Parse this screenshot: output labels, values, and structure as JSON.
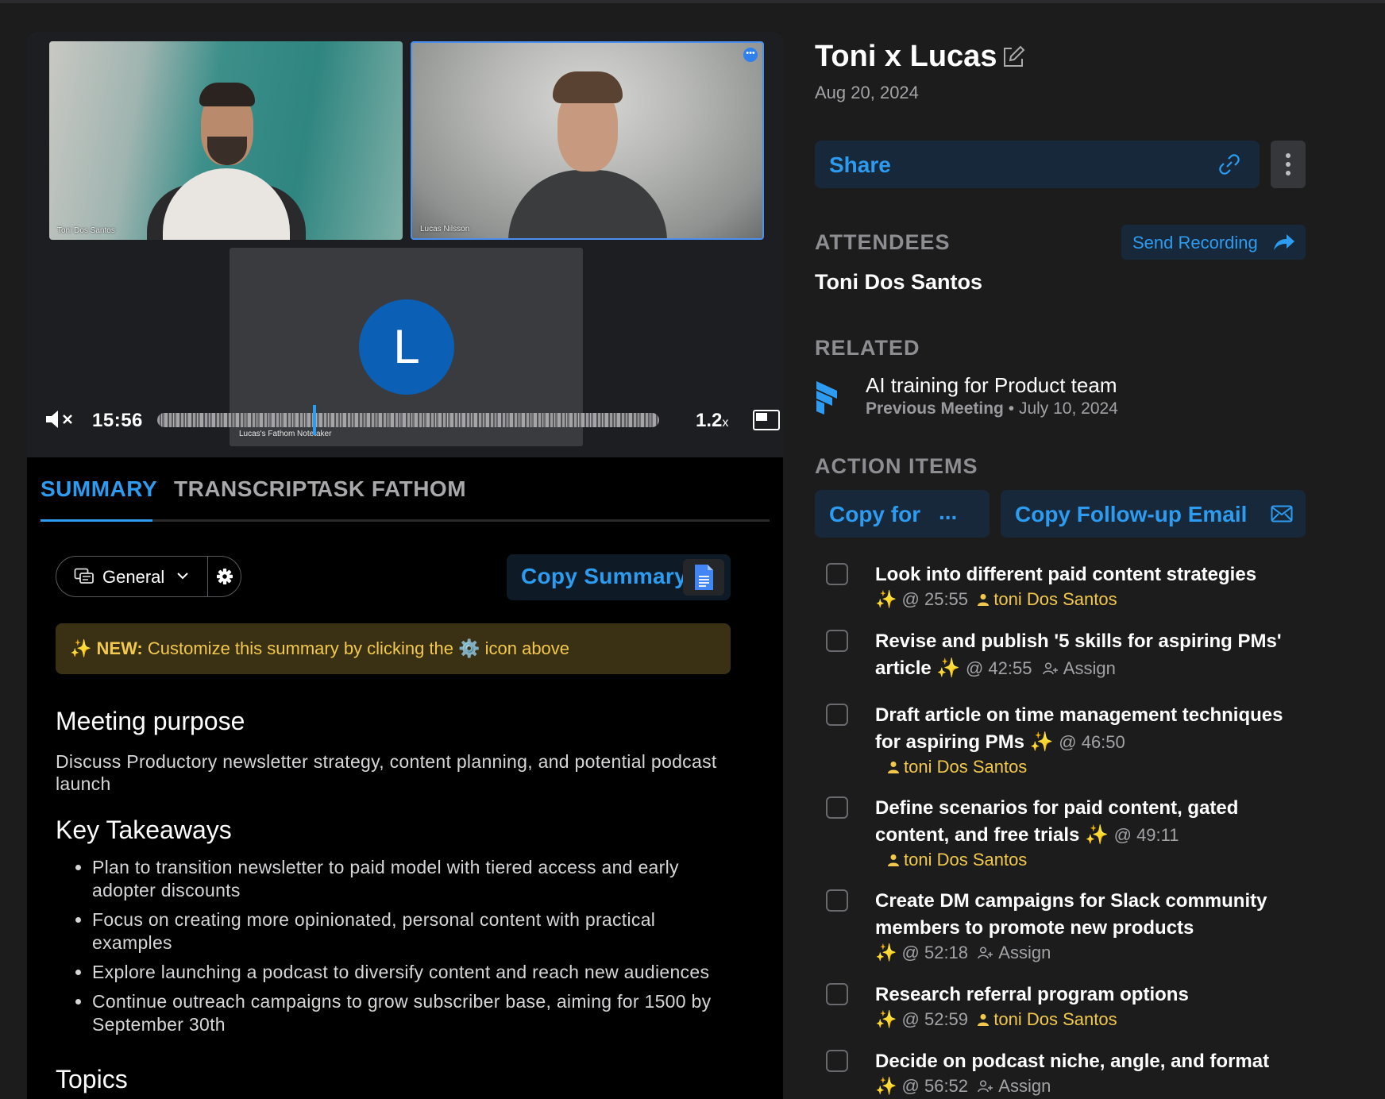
{
  "video": {
    "tile1_name": "Toni Dos Santos",
    "tile2_name": "Lucas Nilsson",
    "notetaker_initial": "L",
    "notetaker_label": "Lucas's Fathom Notetaker",
    "time": "15:56",
    "speed": "1.2",
    "speed_suffix": "x"
  },
  "tabs": [
    "SUMMARY",
    "TRANSCRIPT",
    "ASK FATHOM"
  ],
  "summary": {
    "template_label": "General",
    "copy_label": "Copy Summary",
    "banner_prefix": "✨ NEW:",
    "banner_text": " Customize this summary by clicking the ⚙️ icon above",
    "purpose_heading": "Meeting purpose",
    "purpose_text": "Discuss Productory newsletter strategy, content planning, and potential podcast launch",
    "takeaways_heading": "Key Takeaways",
    "takeaways": [
      "Plan to transition newsletter to paid model with tiered access and early adopter discounts",
      "Focus on creating more opinionated, personal content with practical examples",
      "Explore launching a podcast to diversify content and reach new audiences",
      "Continue outreach campaigns to grow subscriber base, aiming for 1500 by September 30th"
    ],
    "next_heading": "Topics"
  },
  "meeting": {
    "title": "Toni x Lucas",
    "date": "Aug 20, 2024",
    "share_label": "Share"
  },
  "attendees": {
    "heading": "ATTENDEES",
    "send_label": "Send Recording",
    "names": [
      "Toni Dos Santos"
    ]
  },
  "related": {
    "heading": "RELATED",
    "title": "AI training for Product team",
    "kind": "Previous Meeting",
    "separator": "•",
    "date": "July 10, 2024"
  },
  "action_items": {
    "heading": "ACTION ITEMS",
    "copy_for_label": "Copy for",
    "copy_for_more": "...",
    "copy_email_label": "Copy Follow-up Email",
    "assign_label": "Assign",
    "items": [
      {
        "text": "Look into different paid content strategies",
        "time": "@ 25:55",
        "owner": "toni Dos Santos"
      },
      {
        "text": "Revise and publish '5 skills for aspiring PMs' article",
        "time": "@ 42:55",
        "owner": ""
      },
      {
        "text": "Draft article on time management techniques for aspiring PMs",
        "time": "@ 46:50",
        "owner": "toni Dos Santos"
      },
      {
        "text": "Define scenarios for paid content, gated content, and free trials",
        "time": "@ 49:11",
        "owner": "toni Dos Santos"
      },
      {
        "text": "Create DM campaigns for Slack community members to promote new products",
        "time": "@ 52:18",
        "owner": ""
      },
      {
        "text": "Research referral program options",
        "time": "@ 52:59",
        "owner": "toni Dos Santos"
      },
      {
        "text": "Decide on podcast niche, angle, and format",
        "time": "@ 56:52",
        "owner": ""
      }
    ]
  },
  "colors": {
    "accent": "#2d9cf0",
    "highlight": "#f2c94c",
    "background": "#1c1c1d"
  }
}
